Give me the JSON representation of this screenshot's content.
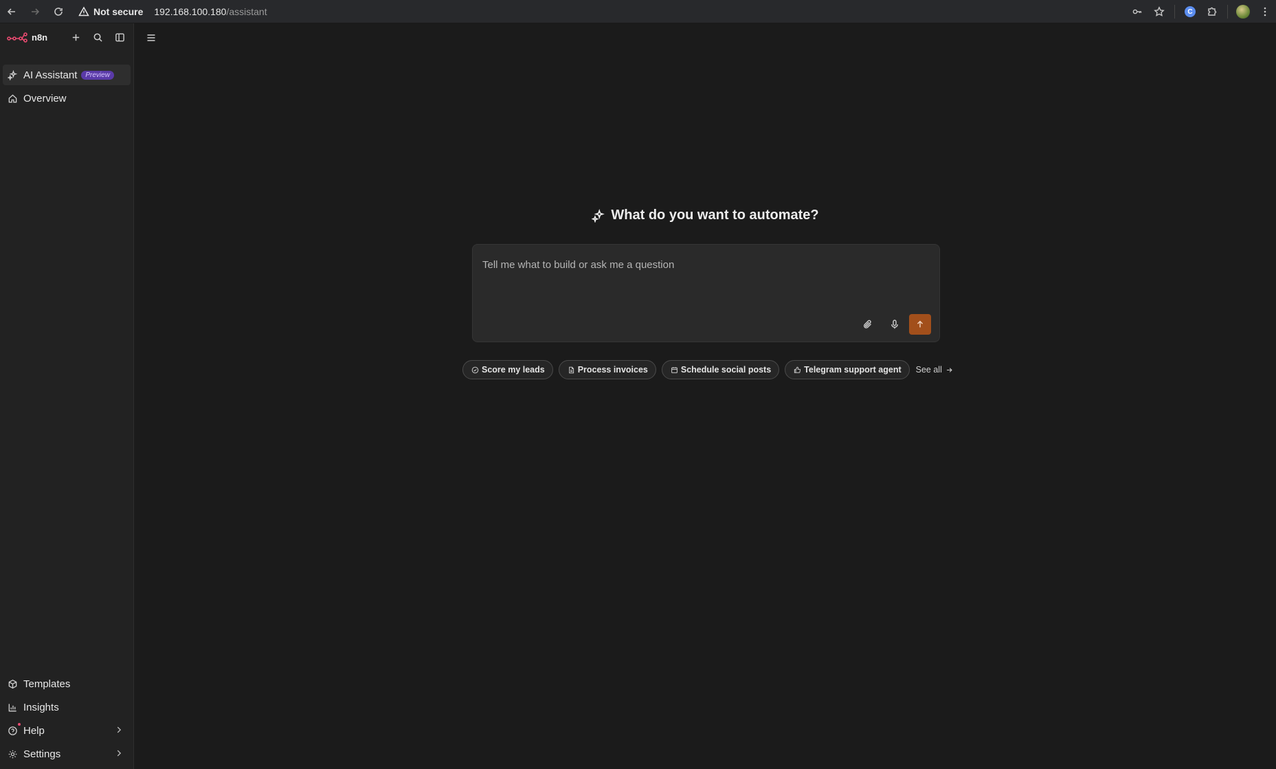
{
  "browser": {
    "security_label": "Not secure",
    "url_host": "192.168.100.180",
    "url_path": "/assistant",
    "profile_initial": "C"
  },
  "sidebar": {
    "logo_text": "n8n",
    "top_items": [
      {
        "label": "AI Assistant",
        "badge": "Preview",
        "icon": "sparkles-icon"
      },
      {
        "label": "Overview",
        "icon": "home-icon"
      }
    ],
    "bottom_items": [
      {
        "label": "Templates",
        "icon": "box-icon"
      },
      {
        "label": "Insights",
        "icon": "chart-bar-icon"
      },
      {
        "label": "Help",
        "icon": "help-circle-icon"
      },
      {
        "label": "Settings",
        "icon": "gear-icon"
      }
    ]
  },
  "main": {
    "heading": "What do you want to automate?",
    "prompt_placeholder": "Tell me what to build or ask me a question",
    "suggestions": [
      {
        "label": "Score my leads",
        "icon": "check-circle-icon"
      },
      {
        "label": "Process invoices",
        "icon": "file-icon"
      },
      {
        "label": "Schedule social posts",
        "icon": "calendar-icon"
      },
      {
        "label": "Telegram support agent",
        "icon": "thumbs-up-icon"
      }
    ],
    "see_all_label": "See all"
  },
  "colors": {
    "accent": "#a24f1b",
    "badge_bg": "#5a3aa8",
    "brand": "#ea4b71"
  }
}
